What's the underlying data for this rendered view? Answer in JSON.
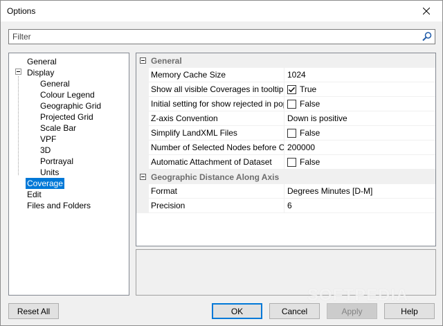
{
  "window": {
    "title": "Options"
  },
  "filter": {
    "placeholder": "Filter",
    "value": ""
  },
  "tree": {
    "items": [
      {
        "label": "General",
        "level": 0
      },
      {
        "label": "Display",
        "level": 0,
        "expanded": true
      },
      {
        "label": "General",
        "level": 1
      },
      {
        "label": "Colour Legend",
        "level": 1
      },
      {
        "label": "Geographic Grid",
        "level": 1
      },
      {
        "label": "Projected Grid",
        "level": 1
      },
      {
        "label": "Scale Bar",
        "level": 1
      },
      {
        "label": "VPF",
        "level": 1
      },
      {
        "label": "3D",
        "level": 1
      },
      {
        "label": "Portrayal",
        "level": 1
      },
      {
        "label": "Units",
        "level": 1
      },
      {
        "label": "Coverage",
        "level": 0,
        "selected": true
      },
      {
        "label": "Edit",
        "level": 0
      },
      {
        "label": "Files and Folders",
        "level": 0
      }
    ]
  },
  "grid": {
    "categories": [
      {
        "name": "General",
        "properties": [
          {
            "name": "Memory Cache Size",
            "value": "1024"
          },
          {
            "name": "Show all visible Coverages in tooltip",
            "value": "True",
            "checkbox": true,
            "checked": true
          },
          {
            "name": "Initial setting for show rejected in popup",
            "value": "False",
            "checkbox": true,
            "checked": false
          },
          {
            "name": "Z-axis Convention",
            "value": "Down is positive"
          },
          {
            "name": "Simplify LandXML Files",
            "value": "False",
            "checkbox": true,
            "checked": false
          },
          {
            "name": "Number of Selected Nodes before Confirmation",
            "value": "200000"
          },
          {
            "name": "Automatic Attachment of Dataset",
            "value": "False",
            "checkbox": true,
            "checked": false
          }
        ]
      },
      {
        "name": "Geographic Distance Along Axis",
        "properties": [
          {
            "name": "Format",
            "value": "Degrees Minutes [D-M]"
          },
          {
            "name": "Precision",
            "value": "6"
          }
        ]
      }
    ]
  },
  "buttons": {
    "reset_all": "Reset All",
    "ok": "OK",
    "cancel": "Cancel",
    "apply": "Apply",
    "help": "Help"
  },
  "icons": {
    "close": "close-icon",
    "search": "search-icon",
    "checkmark": "checkmark-icon",
    "collapse": "collapse-icon"
  },
  "colors": {
    "selection": "#0078d7",
    "window_bg": "#f0f0f0",
    "default_button_border": "#0078d7"
  },
  "watermark": "SOFTPEDIA"
}
